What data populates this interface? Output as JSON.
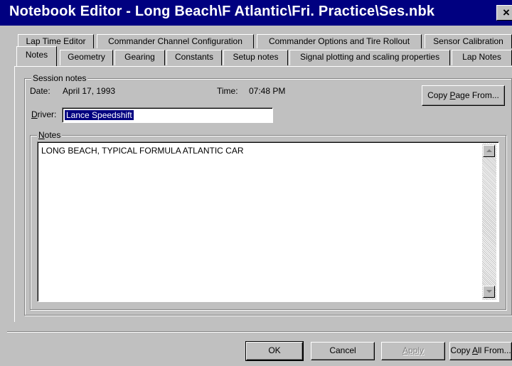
{
  "window": {
    "title": "Notebook Editor - Long Beach\\F Atlantic\\Fri. Practice\\Ses.nbk",
    "close_glyph": "×"
  },
  "tabs_back": [
    {
      "label": "Lap Time Editor"
    },
    {
      "label": "Commander Channel Configuration"
    },
    {
      "label": "Commander Options and Tire Rollout"
    },
    {
      "label": "Sensor Calibration"
    }
  ],
  "tabs_front": [
    {
      "label": "Notes",
      "active": true
    },
    {
      "label": "Geometry"
    },
    {
      "label": "Gearing"
    },
    {
      "label": "Constants"
    },
    {
      "label": "Setup notes"
    },
    {
      "label": "Signal plotting and scaling properties"
    },
    {
      "label": "Lap Notes"
    }
  ],
  "session": {
    "group_label": "Session notes",
    "date_label": "Date:",
    "date_value": "April 17, 1993",
    "time_label": "Time:",
    "time_value": "07:48 PM",
    "copy_page_label_pre": "Copy ",
    "copy_page_label_accel": "P",
    "copy_page_label_post": "age From...",
    "driver_label_accel": "D",
    "driver_label_post": "river:",
    "driver_value": "Lance Speedshift",
    "notes_label_accel": "N",
    "notes_label_post": "otes",
    "notes_text": "LONG BEACH, TYPICAL FORMULA ATLANTIC CAR"
  },
  "buttons": {
    "ok": "OK",
    "cancel": "Cancel",
    "apply": "Apply",
    "copy_all_pre": "Copy ",
    "copy_all_accel": "A",
    "copy_all_post": "ll From..."
  }
}
